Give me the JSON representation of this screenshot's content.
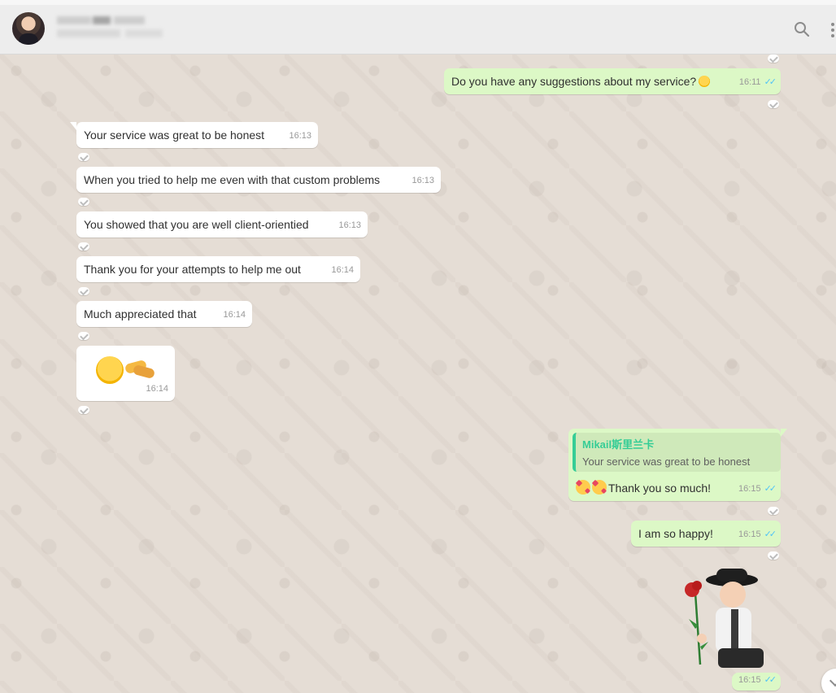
{
  "header": {
    "contact_name_redacted": "",
    "search_icon": "search-icon",
    "menu_icon": "more-vertical-icon"
  },
  "messages": [
    {
      "dir": "out",
      "text": "Do you have any suggestions about my service?",
      "time": "16:11"
    },
    {
      "dir": "in",
      "text": "Your service was great to be honest",
      "time": "16:13"
    },
    {
      "dir": "in",
      "text": "When you tried to help me even with that custom problems",
      "time": "16:13"
    },
    {
      "dir": "in",
      "text": "You showed that you are well client-orientied",
      "time": "16:13"
    },
    {
      "dir": "in",
      "text": "Thank you for your attempts to help me out",
      "time": "16:14"
    },
    {
      "dir": "in",
      "text": "Much appreciated that",
      "time": "16:14"
    },
    {
      "dir": "in",
      "text": "",
      "time": "16:14"
    },
    {
      "dir": "out",
      "quote_name": "Mikail斯里兰卡",
      "quote_text": "Your service was great to be honest",
      "text": "Thank you so much!",
      "time": "16:15"
    },
    {
      "dir": "out",
      "text": "I am so happy!",
      "time": "16:15"
    },
    {
      "dir": "out",
      "text": "",
      "time": "16:15"
    }
  ],
  "colors": {
    "incoming_bubble": "#ffffff",
    "outgoing_bubble": "#dcf8c6",
    "read_ticks": "#4fc3f7",
    "quote_accent": "#35cd96",
    "chat_background": "#e5ddd5"
  }
}
